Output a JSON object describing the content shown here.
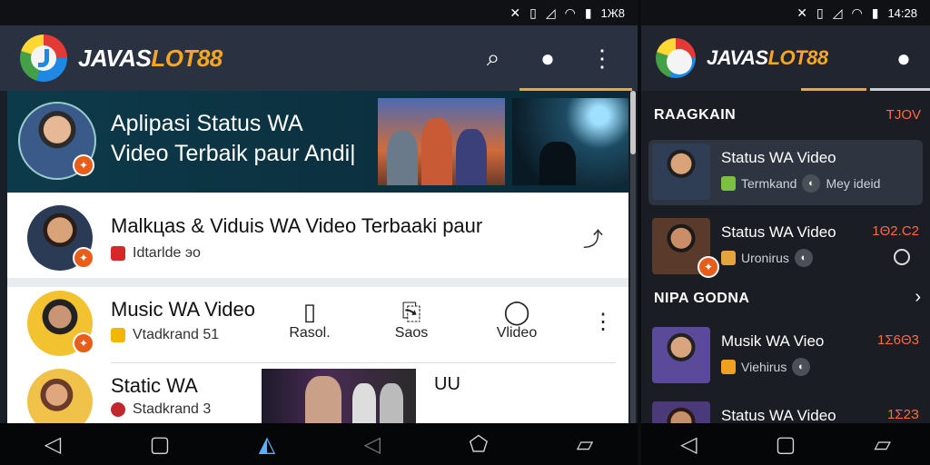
{
  "left": {
    "status": {
      "icons": [
        "mute-icon",
        "vibrate-icon",
        "signal-icon",
        "wifi-icon",
        "battery-icon"
      ],
      "time": "1Ж8"
    },
    "appbar": {
      "brand_white": "JAVAS",
      "brand_orange": "LOT88"
    },
    "banner": {
      "title_line1": "Aplipasi Status WA",
      "title_line2": "Video Terbaik paur Andi|"
    },
    "row1": {
      "title": "Malkцas & Viduis WA Video Terbaaki paur",
      "sub": "Idtarlde эo"
    },
    "row2": {
      "title": "Music WA Video",
      "sub": "Vtadkrand 51",
      "actions": [
        "Rasol.",
        "Saos",
        "Vlideo"
      ]
    },
    "row3": {
      "title": "Static WA",
      "sub": "Stadkrand 3",
      "extra": "UU"
    }
  },
  "right": {
    "status": {
      "time": "14:28"
    },
    "appbar": {
      "brand_white": "JAVAS",
      "brand_orange": "LOT88"
    },
    "section1": {
      "title": "RAAGKAIN",
      "link": "TJOV"
    },
    "items": [
      {
        "title": "Status WA Video",
        "tag": "Termkand",
        "extra": "Mey ideid",
        "count": ""
      },
      {
        "title": "Status WA Video",
        "tag": "Uronirus",
        "extra": "",
        "count": "1Θ2.С2"
      }
    ],
    "section2": {
      "title": "NIPA GODNA"
    },
    "items2": [
      {
        "title": "Musik WA Vieo",
        "tag": "Viehirus",
        "count": "1Σ6Θ3"
      },
      {
        "title": "Status WA Video",
        "count": "1Σ2З"
      }
    ]
  },
  "colors": {
    "accent": "#f5a623",
    "count": "#ff6a3d",
    "badge": "#e85d1a"
  }
}
